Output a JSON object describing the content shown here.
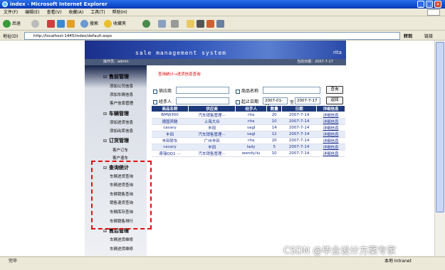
{
  "window": {
    "title": "index - Microsoft Internet Explorer"
  },
  "menu": [
    "文件(F)",
    "编辑(E)",
    "查看(V)",
    "收藏(A)",
    "工具(T)",
    "帮助(H)"
  ],
  "toolbar": {
    "back": "后退",
    "search": "搜索",
    "favorites": "收藏夹"
  },
  "address": {
    "label": "地址(D)",
    "url": "http://localhost:1445/index/default.aspx",
    "go": "转到",
    "links": "链接"
  },
  "banner": {
    "text": "sale management system",
    "tag": "rita"
  },
  "infobar": {
    "operator": "操作员：admin",
    "date": "当前日期：2007-7-17"
  },
  "sidebar": {
    "sections": [
      {
        "title": "售前管理",
        "items": [
          "添加公司信息",
          "添加车辆信息",
          "客户信息管理"
        ]
      },
      {
        "title": "车辆管理",
        "items": [
          "添加进货信息",
          "添加出库信息"
        ]
      },
      {
        "title": "订货管理",
        "items": [
          "客户订车",
          "客户退车"
        ]
      },
      {
        "title": "查询统计",
        "items": [
          "车辆进货查询",
          "车辆进货查询",
          "车辆销售查询",
          "销售退货查询",
          "车辆库存查询",
          "车辆销售排行"
        ]
      },
      {
        "title": "售后管理",
        "items": [
          "车辆进货维修",
          "车辆进货维修"
        ]
      }
    ]
  },
  "breadcrumb": "查询统计→进货信息查询",
  "form": {
    "supplier": "供应商",
    "product": "商品名称",
    "handler": "经手人",
    "date_range": "起止日期",
    "date_from": "2007-01-01",
    "date_to_label": "至",
    "date_to": "2007-7-17",
    "query_btn": "查询",
    "back_btn": "返回"
  },
  "table": {
    "headers": [
      "商品名称",
      "供应商",
      "经手人",
      "数量",
      "日期",
      "详细信息"
    ],
    "rows": [
      [
        "BMW300",
        "汽车销售管理···",
        "rita",
        "20",
        "2007-7-14",
        "详细信息"
      ],
      [
        "德国宾馳",
        "上海大众",
        "rita",
        "10",
        "2007-7-14",
        "详细信息"
      ],
      [
        "cavary",
        "丰田",
        "vagl",
        "14",
        "2007-7-14",
        "详细信息"
      ],
      [
        "丰田",
        "汽车销售管理···",
        "vagl",
        "12",
        "2007-7-14",
        "详细信息"
      ],
      [
        "丰田轿车",
        "广州丰田",
        "rita",
        "20",
        "2007-7-14",
        "详细信息"
      ],
      [
        "cavary",
        "丰田",
        "lady",
        "5",
        "2007-7-14",
        "详细信息"
      ],
      [
        "奇瑞QQ1 ···",
        "汽车销售管理···",
        "wendy.liu",
        "10",
        "2007-7-14",
        "详细信息"
      ]
    ]
  },
  "status": {
    "left": "完毕",
    "right": "本地 Intranet"
  },
  "watermark": "CSDN @毕业设计方案专家"
}
